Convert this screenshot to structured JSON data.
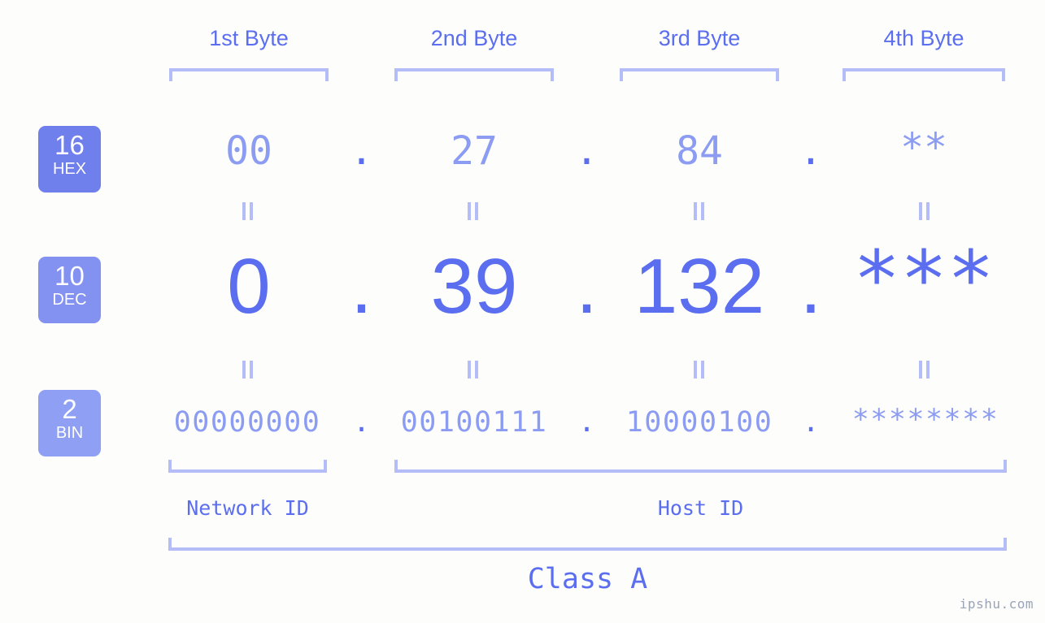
{
  "meta": {
    "watermark": "ipshu.com",
    "accent_color": "#5b6ef0",
    "muted_color": "#8b9cf2",
    "bracket_color": "#b4bdf7",
    "background_color": "#fdfefb"
  },
  "byte_headers": [
    {
      "label": "1st Byte"
    },
    {
      "label": "2nd Byte"
    },
    {
      "label": "3rd Byte"
    },
    {
      "label": "4th Byte"
    }
  ],
  "bases": [
    {
      "number": "16",
      "name": "HEX",
      "color": "#6f7fec"
    },
    {
      "number": "10",
      "name": "DEC",
      "color": "#8391f0"
    },
    {
      "number": "2",
      "name": "BIN",
      "color": "#8fa0f4"
    }
  ],
  "separator": ".",
  "equals_symbol": "=",
  "rows": {
    "hex": {
      "base": "16",
      "name": "HEX",
      "values": [
        "00",
        "27",
        "84",
        "**"
      ]
    },
    "dec": {
      "base": "10",
      "name": "DEC",
      "values": [
        "0",
        "39",
        "132",
        "***"
      ]
    },
    "bin": {
      "base": "2",
      "name": "BIN",
      "values": [
        "00000000",
        "00100111",
        "10000100",
        "********"
      ]
    }
  },
  "sections": {
    "network_id": "Network ID",
    "host_id": "Host ID",
    "class": "Class A"
  },
  "chart_data": {
    "type": "table",
    "title": "IP Address Byte Breakdown",
    "categories": [
      "1st Byte",
      "2nd Byte",
      "3rd Byte",
      "4th Byte"
    ],
    "series": [
      {
        "name": "HEX",
        "values": [
          "00",
          "27",
          "84",
          "**"
        ]
      },
      {
        "name": "DEC",
        "values": [
          "0",
          "39",
          "132",
          "***"
        ]
      },
      {
        "name": "BIN",
        "values": [
          "00000000",
          "00100111",
          "10000100",
          "********"
        ]
      }
    ],
    "annotations": {
      "network_id_bytes": [
        "1st Byte"
      ],
      "host_id_bytes": [
        "2nd Byte",
        "3rd Byte",
        "4th Byte"
      ],
      "class": "Class A"
    }
  }
}
